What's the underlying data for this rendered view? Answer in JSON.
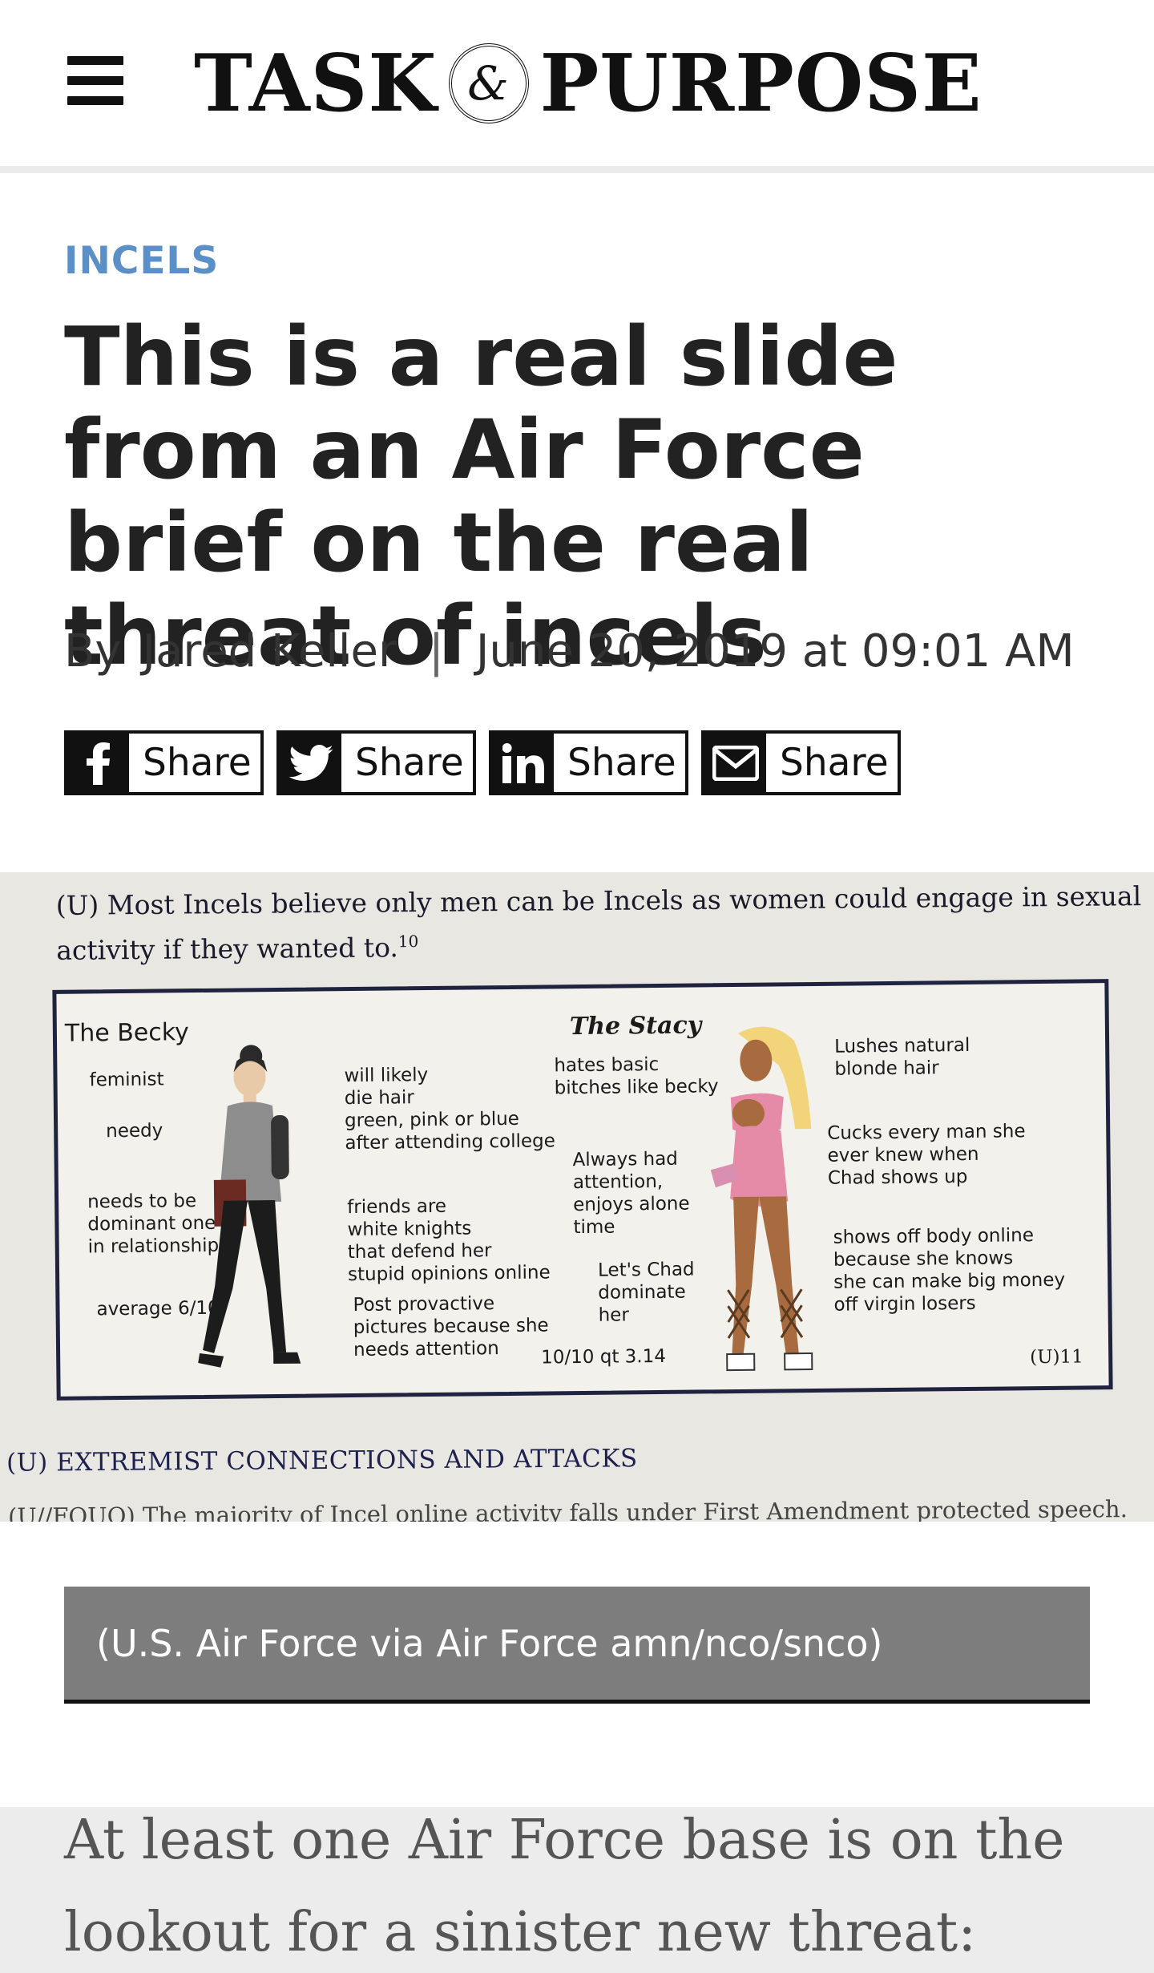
{
  "header": {
    "logo_left": "TASK",
    "logo_amp": "&",
    "logo_right": "PURPOSE"
  },
  "article": {
    "category": "INCELS",
    "headline": "This is a real slide from an Air Force brief on the real threat of incels",
    "byline": {
      "by": "By",
      "author": "Jared Keller",
      "separator": "|",
      "date": "June 20, 2019 at 09:01 AM"
    }
  },
  "share_buttons": [
    {
      "network": "facebook",
      "icon": "facebook-icon",
      "label": "Share"
    },
    {
      "network": "twitter",
      "icon": "twitter-icon",
      "label": "Share"
    },
    {
      "network": "linkedin",
      "icon": "linkedin-icon",
      "label": "Share"
    },
    {
      "network": "email",
      "icon": "email-icon",
      "label": "Share"
    }
  ],
  "slide": {
    "top_text": "(U) Most Incels believe only men can be Incels as women could engage in sexual activity if they wanted to.",
    "top_sup": "10",
    "becky": {
      "title": "The Becky",
      "feminist": "feminist",
      "needy": "needy",
      "dominant": "needs to be\ndominant one\nin relationship",
      "average": "average 6/10",
      "hair": "will likely\ndie hair\ngreen, pink or blue\nafter attending college",
      "friends": "friends are\nwhite knights\nthat defend her\nstupid opinions online",
      "pictures": "Post provactive\npictures because she\nneeds attention"
    },
    "stacy": {
      "title": "The Stacy",
      "hates": "hates basic\nbitches like becky",
      "attention": "Always had\nattention,\nenjoys alone\ntime",
      "chad": "Let's Chad\ndominate\nher",
      "rating": "10/10 qt 3.14",
      "blonde": "Lushes natural\nblonde hair",
      "cucks": "Cucks every man she\never knew when\nChad shows up",
      "shows": "shows off body online\nbecause she knows\nshe can make big money\noff virgin losers"
    },
    "marking": "(U)11",
    "section_heading": "(U) EXTREMIST CONNECTIONS AND ATTACKS",
    "cutoff_line": "(U//FOUO) The majority of Incel online activity falls under First Amendment protected speech."
  },
  "caption": "(U.S. Air Force via Air Force amn/nco/snco)",
  "body_text": "At least one Air Force base is on the lookout for a sinister new threat:",
  "colors": {
    "category": "#5b8fc7",
    "caption_bg": "#7d7d7d",
    "slide_navy": "#1f2340"
  }
}
